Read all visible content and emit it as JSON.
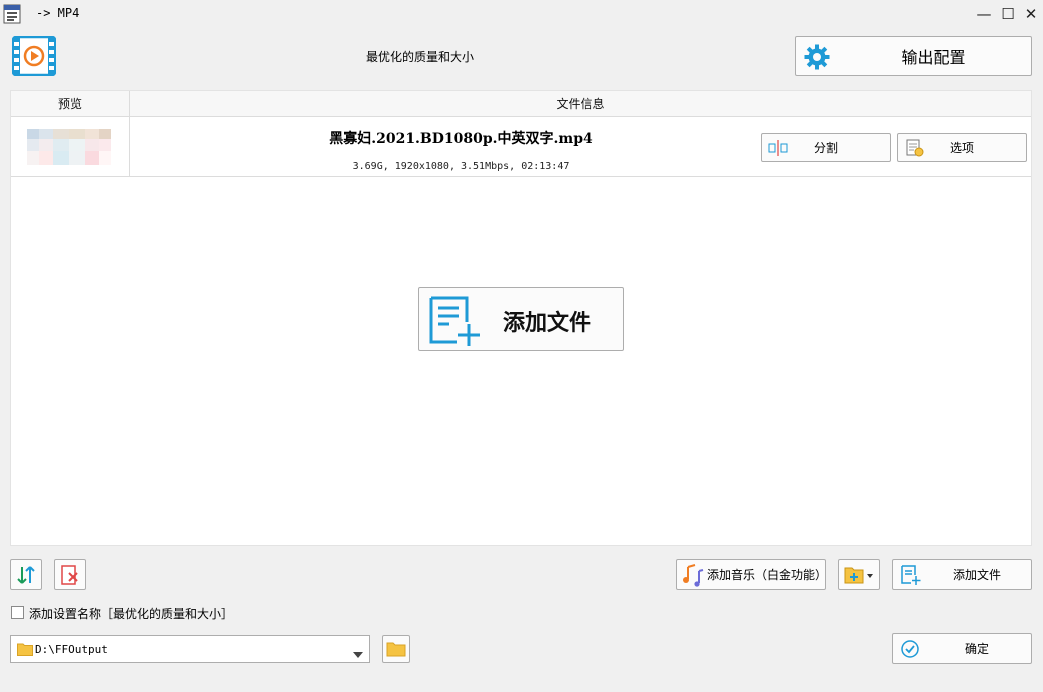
{
  "window": {
    "title": "-> MP4",
    "minimize": "—",
    "maximize": "☐",
    "close": "✕"
  },
  "header": {
    "preset_name": "最优化的质量和大小",
    "output_config_label": "输出配置"
  },
  "file_list": {
    "columns": [
      "预览",
      "文件信息"
    ],
    "files": [
      {
        "name": "黑寡妇.2021.BD1080p.中英双字.mp4",
        "info": "3.69G, 1920x1080, 3.51Mbps, 02:13:47",
        "split_label": "分割",
        "options_label": "选项"
      }
    ],
    "add_file_center_label": "添加文件"
  },
  "bottom": {
    "add_music_label": "添加音乐（白金功能）",
    "add_file_label": "添加文件",
    "add_preset_name_label": "添加设置名称［最优化的质量和大小］",
    "add_preset_name_checked": false,
    "output_path": "D:\\FFOutput",
    "confirm_label": "确定"
  },
  "colors": {
    "accent_blue": "#1e9ad6",
    "icon_orange": "#f07d23",
    "folder_yellow": "#f5c342",
    "red_x": "#e04646",
    "green_arrow": "#1a9b5a"
  }
}
